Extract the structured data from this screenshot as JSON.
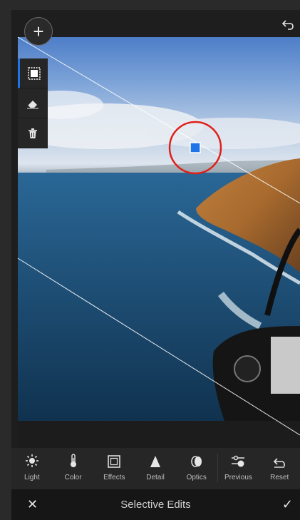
{
  "toolbar": {
    "tools": [
      {
        "label": "Light",
        "icon": "sun-icon"
      },
      {
        "label": "Color",
        "icon": "thermometer-icon"
      },
      {
        "label": "Effects",
        "icon": "effects-frame-icon"
      },
      {
        "label": "Detail",
        "icon": "triangle-icon"
      },
      {
        "label": "Optics",
        "icon": "lens-icon"
      },
      {
        "label": "Previous",
        "icon": "previous-sliders-icon"
      },
      {
        "label": "Reset",
        "icon": "reset-arrow-icon"
      }
    ]
  },
  "bottom_bar": {
    "title": "Selective Edits",
    "cancel_icon": "close-icon",
    "confirm_icon": "check-icon"
  },
  "side_tools": [
    "linear-gradient-mask-icon",
    "eraser-icon",
    "trash-icon"
  ],
  "colors": {
    "accent": "#1f74e8",
    "highlight_circle": "#e0201a",
    "background": "#1e1e1e"
  }
}
